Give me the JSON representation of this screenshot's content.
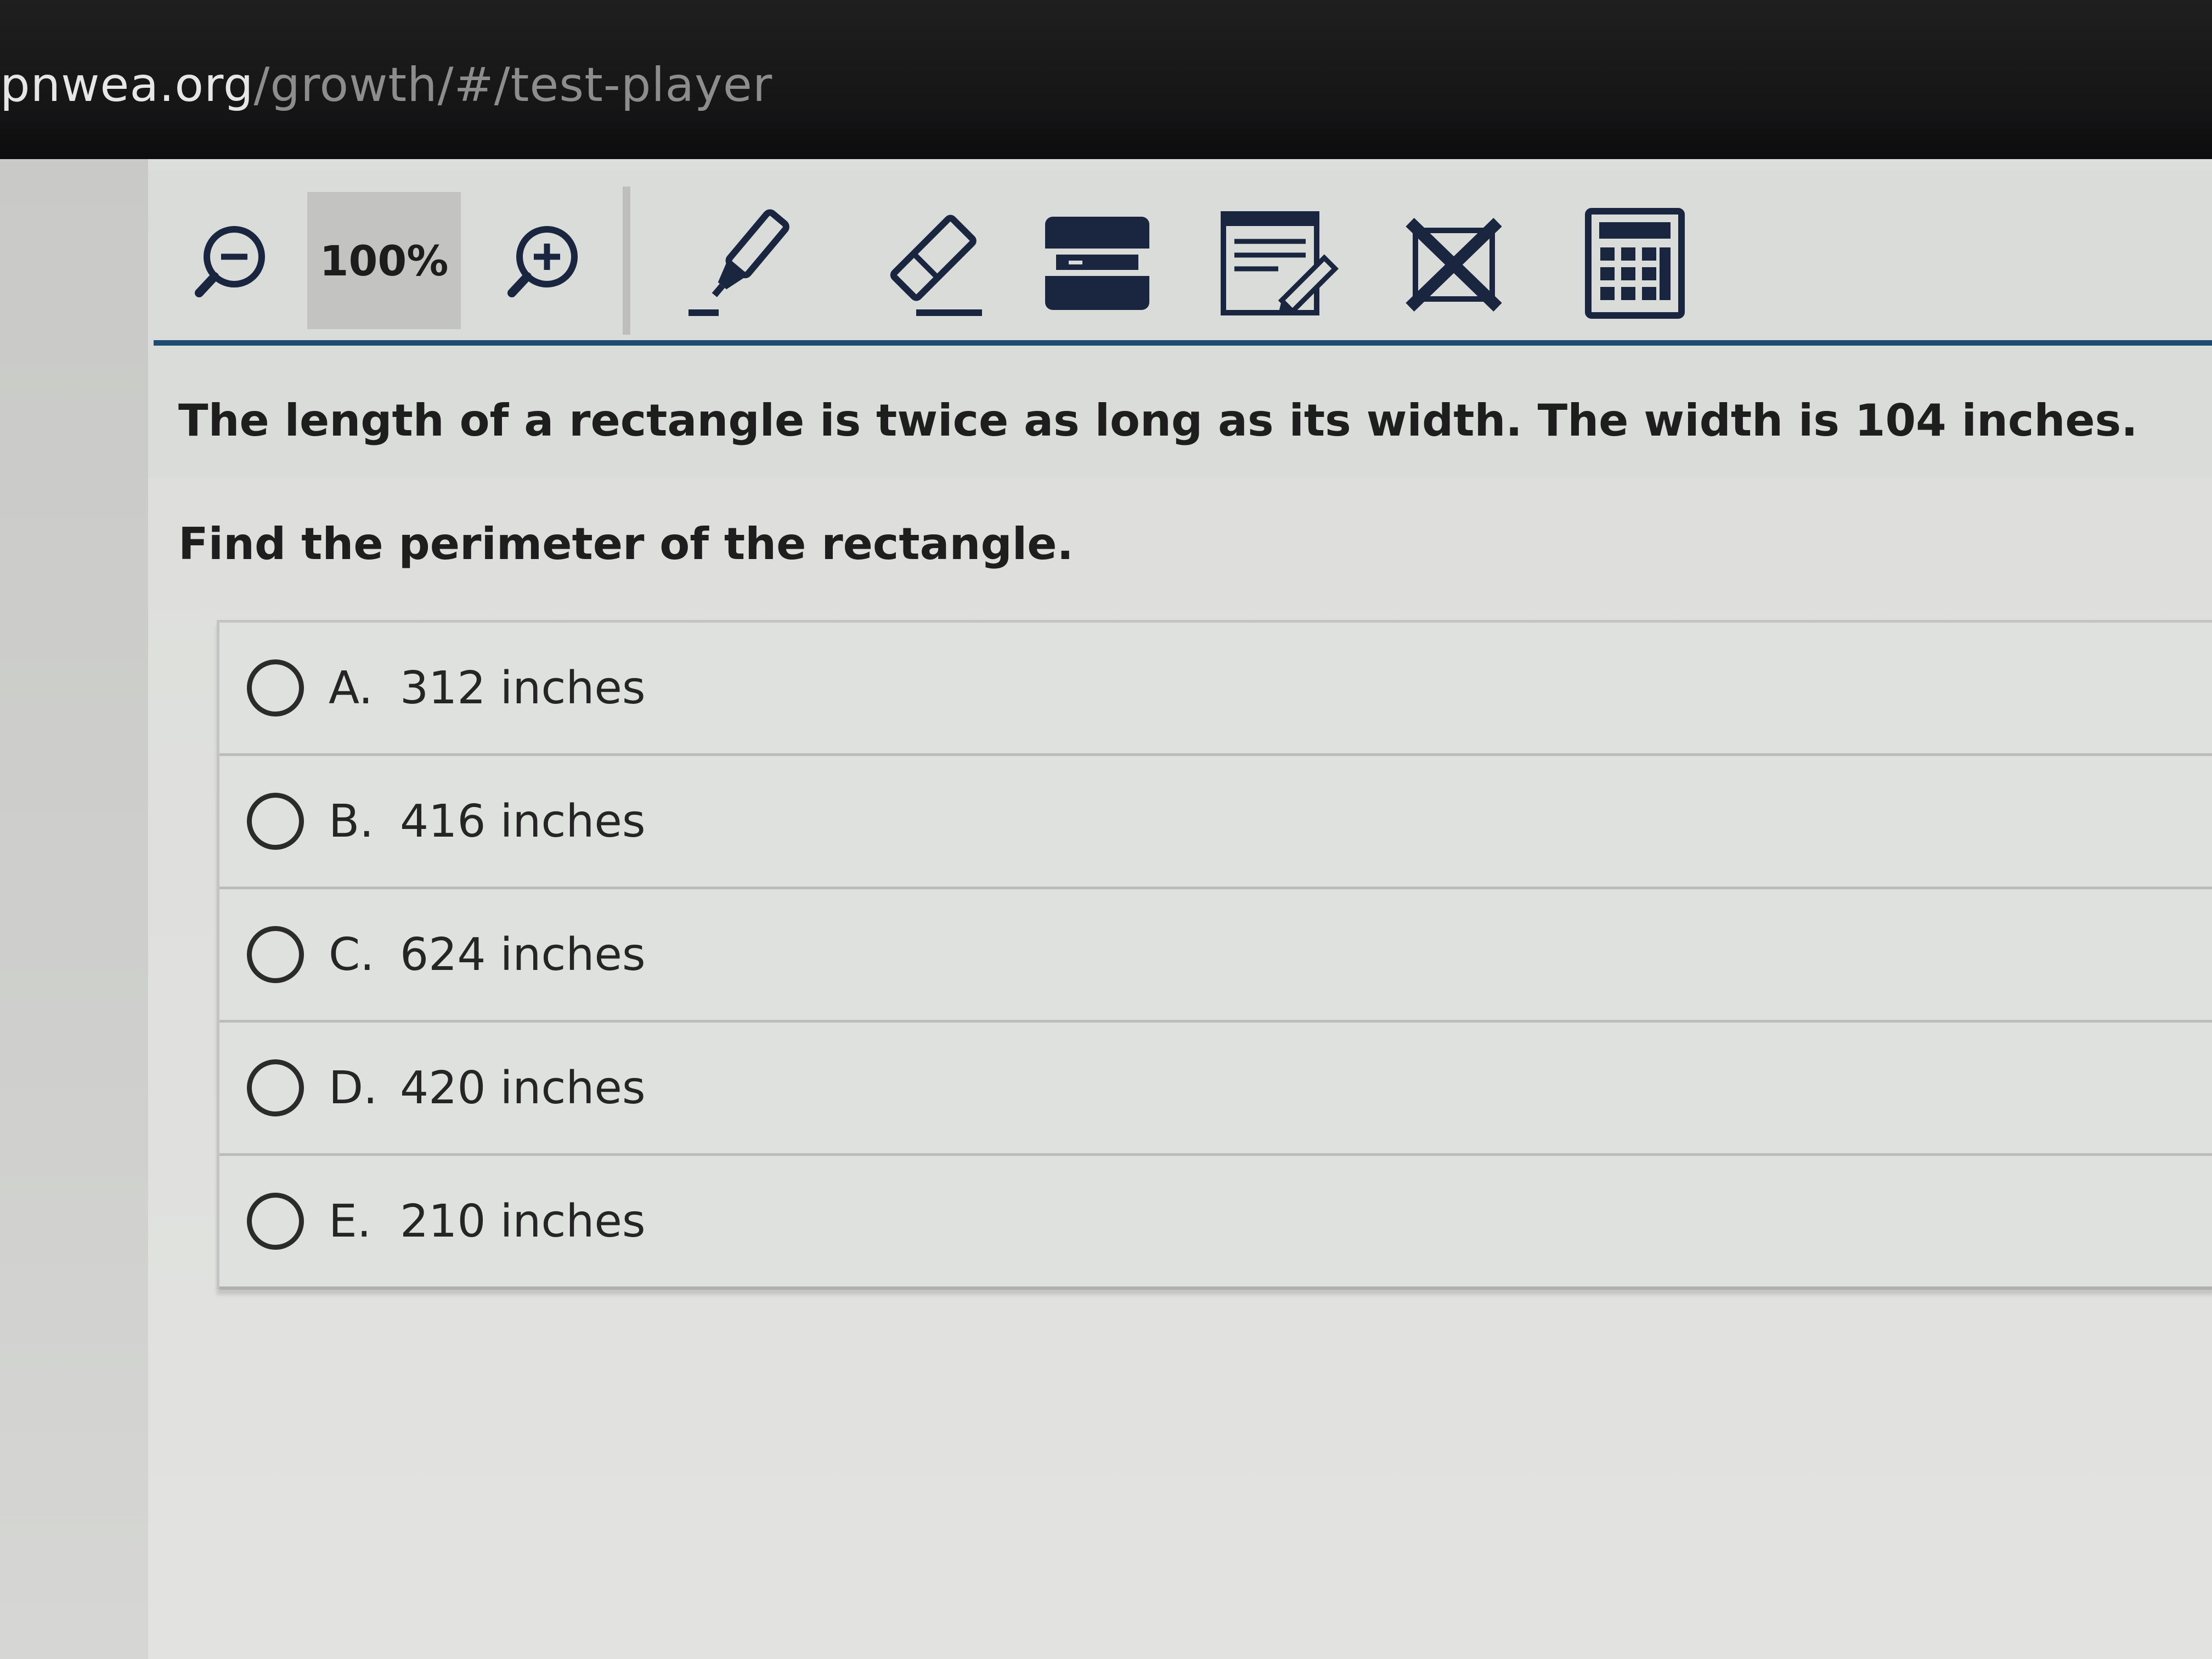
{
  "browser": {
    "url_host": "pnwea.org",
    "url_path": "/growth/#/test-player"
  },
  "toolbar": {
    "zoom_level": "100%",
    "tools": [
      {
        "name": "zoom-out-icon"
      },
      {
        "name": "zoom-in-icon"
      },
      {
        "name": "highlighter-icon"
      },
      {
        "name": "eraser-icon"
      },
      {
        "name": "line-reader-icon"
      },
      {
        "name": "notepad-icon"
      },
      {
        "name": "answer-eliminator-icon"
      },
      {
        "name": "calculator-icon"
      }
    ],
    "accent_color": "#1f4a72"
  },
  "question": {
    "stem_line_1": "The length of a rectangle is twice as long as its width. The width is 104 inches.",
    "stem_line_2": "Find the perimeter of the rectangle.",
    "choices": [
      {
        "letter": "A.",
        "text": "312 inches",
        "selected": false
      },
      {
        "letter": "B.",
        "text": "416 inches",
        "selected": false
      },
      {
        "letter": "C.",
        "text": "624 inches",
        "selected": false
      },
      {
        "letter": "D.",
        "text": "420 inches",
        "selected": false
      },
      {
        "letter": "E.",
        "text": "210 inches",
        "selected": false
      }
    ]
  }
}
